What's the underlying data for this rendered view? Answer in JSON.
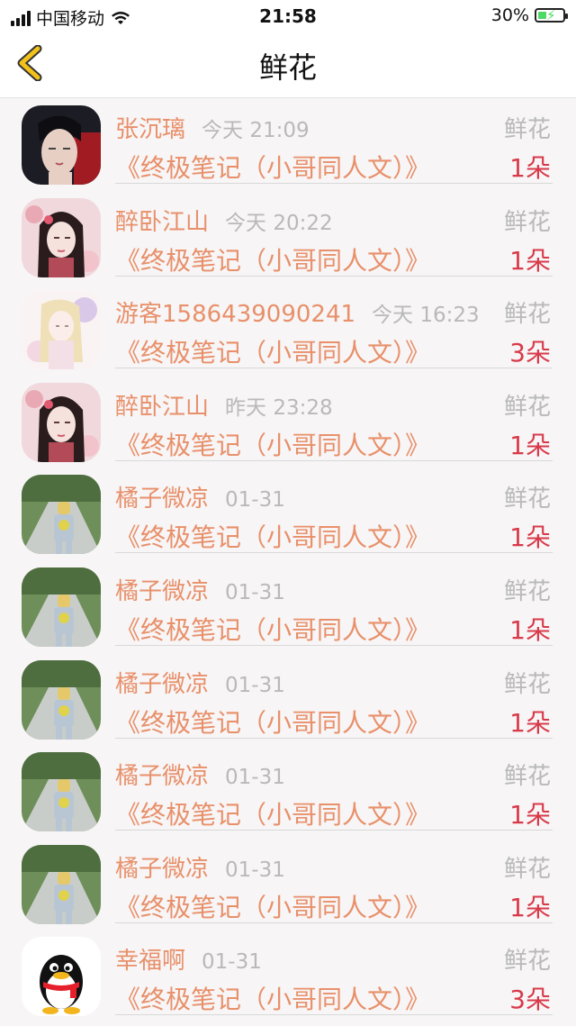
{
  "status": {
    "carrier": "中国移动",
    "time": "21:58",
    "battery": "30%",
    "battery_level": 0.3
  },
  "header": {
    "title": "鲜花"
  },
  "colors": {
    "accent": "#e8906a",
    "count": "#d83a4a",
    "muted": "#b9b9b9",
    "back_arrow": "#f2c21a"
  },
  "items": [
    {
      "name": "张沉璃",
      "time": "今天 21:09",
      "type": "鲜花",
      "book": "《终极笔记（小哥同人文）》",
      "count": "1朵",
      "avatar": "portrait-boy"
    },
    {
      "name": "醉卧江山",
      "time": "今天 20:22",
      "type": "鲜花",
      "book": "《终极笔记（小哥同人文）》",
      "count": "1朵",
      "avatar": "portrait-girl"
    },
    {
      "name": "游客1586439090241",
      "time": "今天 16:23",
      "type": "鲜花",
      "book": "《终极笔记（小哥同人文）》",
      "count": "3朵",
      "avatar": "portrait-angel"
    },
    {
      "name": "醉卧江山",
      "time": "昨天 23:28",
      "type": "鲜花",
      "book": "《终极笔记（小哥同人文）》",
      "count": "1朵",
      "avatar": "portrait-girl"
    },
    {
      "name": "橘子微凉",
      "time": "01-31",
      "type": "鲜花",
      "book": "《终极笔记（小哥同人文）》",
      "count": "1朵",
      "avatar": "road-figure"
    },
    {
      "name": "橘子微凉",
      "time": "01-31",
      "type": "鲜花",
      "book": "《终极笔记（小哥同人文）》",
      "count": "1朵",
      "avatar": "road-figure"
    },
    {
      "name": "橘子微凉",
      "time": "01-31",
      "type": "鲜花",
      "book": "《终极笔记（小哥同人文）》",
      "count": "1朵",
      "avatar": "road-figure"
    },
    {
      "name": "橘子微凉",
      "time": "01-31",
      "type": "鲜花",
      "book": "《终极笔记（小哥同人文）》",
      "count": "1朵",
      "avatar": "road-figure"
    },
    {
      "name": "橘子微凉",
      "time": "01-31",
      "type": "鲜花",
      "book": "《终极笔记（小哥同人文）》",
      "count": "1朵",
      "avatar": "road-figure"
    },
    {
      "name": "幸福啊",
      "time": "01-31",
      "type": "鲜花",
      "book": "《终极笔记（小哥同人文）》",
      "count": "3朵",
      "avatar": "qq-penguin"
    }
  ]
}
